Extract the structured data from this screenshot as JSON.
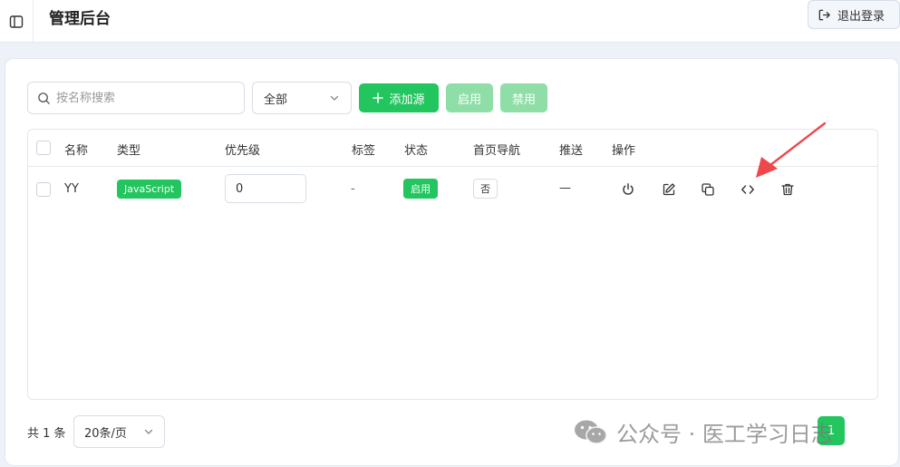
{
  "header": {
    "title": "管理后台",
    "logout_label": "退出登录"
  },
  "toolbar": {
    "search_placeholder": "按名称搜索",
    "filter_value": "全部",
    "add_label": "添加源",
    "enable_label": "启用",
    "disable_label": "禁用"
  },
  "table": {
    "columns": [
      "名称",
      "类型",
      "优先级",
      "标签",
      "状态",
      "首页导航",
      "推送",
      "操作"
    ],
    "rows": [
      {
        "name": "YY",
        "type": "JavaScript",
        "priority": "0",
        "tags": "-",
        "status": "启用",
        "home_nav": "否",
        "push": "—"
      }
    ]
  },
  "footer": {
    "total": "共 1 条",
    "page_size": "20条/页",
    "current_page": "1"
  },
  "watermark": {
    "text": "公众号 · 医工学习日志"
  },
  "colors": {
    "primary": "#22c55e",
    "primary_disabled": "#8fdea8",
    "annotation_arrow": "#f0474b"
  }
}
